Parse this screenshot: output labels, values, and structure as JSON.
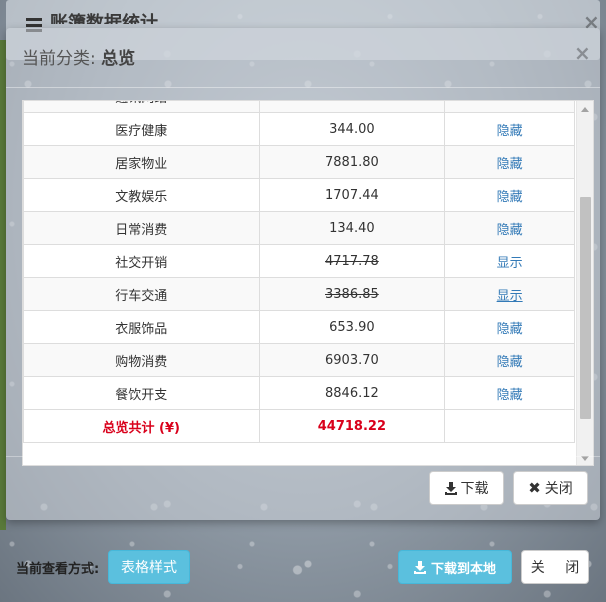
{
  "background_window": {
    "title": "账簿数据统计"
  },
  "modal": {
    "title_prefix": "当前分类:",
    "title_value": "总览"
  },
  "table": {
    "partial_top_row": {
      "category": "通讯网络"
    },
    "rows": [
      {
        "category": "医疗健康",
        "amount": "344.00",
        "action": "隐藏",
        "hidden": false
      },
      {
        "category": "居家物业",
        "amount": "7881.80",
        "action": "隐藏",
        "hidden": false
      },
      {
        "category": "文教娱乐",
        "amount": "1707.44",
        "action": "隐藏",
        "hidden": false
      },
      {
        "category": "日常消费",
        "amount": "134.40",
        "action": "隐藏",
        "hidden": false
      },
      {
        "category": "社交开销",
        "amount": "4717.78",
        "action": "显示",
        "hidden": true
      },
      {
        "category": "行车交通",
        "amount": "3386.85",
        "action": "显示",
        "hidden": true
      },
      {
        "category": "衣服饰品",
        "amount": "653.90",
        "action": "隐藏",
        "hidden": false
      },
      {
        "category": "购物消费",
        "amount": "6903.70",
        "action": "隐藏",
        "hidden": false
      },
      {
        "category": "餐饮开支",
        "amount": "8846.12",
        "action": "隐藏",
        "hidden": false
      }
    ],
    "total_label": "总览共计 (¥)",
    "total_value": "44718.22"
  },
  "modal_footer": {
    "download_label": "下载",
    "close_label": "关闭"
  },
  "bottom_bar": {
    "view_mode_label": "当前查看方式:",
    "view_mode_button": "表格样式",
    "download_local_label": "下载到本地",
    "close_label": "关 闭"
  },
  "colors": {
    "link": "#337ab7",
    "total_red": "#d9001b",
    "info_button": "#5bc0de"
  }
}
